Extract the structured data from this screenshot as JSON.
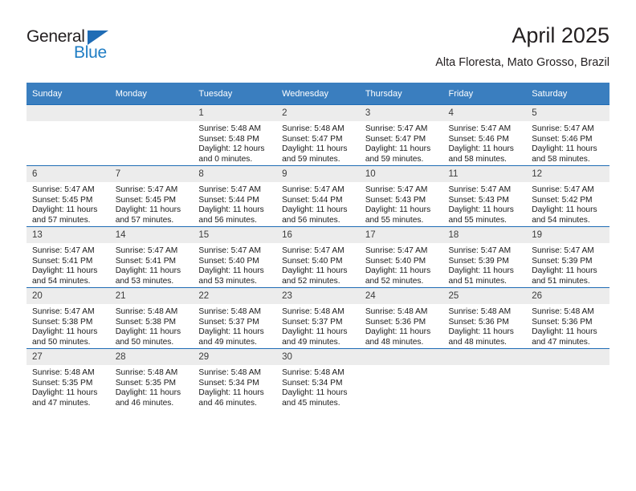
{
  "brand": {
    "name_top": "General",
    "name_bottom": "Blue",
    "accent_color": "#1f7dc4"
  },
  "header": {
    "title": "April 2025",
    "subtitle": "Alta Floresta, Mato Grosso, Brazil"
  },
  "calendar": {
    "header_bg": "#3a7ebf",
    "daynum_bg": "#ececec",
    "border_color": "#1f6cb5",
    "weekdays": [
      "Sunday",
      "Monday",
      "Tuesday",
      "Wednesday",
      "Thursday",
      "Friday",
      "Saturday"
    ],
    "weeks": [
      [
        {
          "day": "",
          "sunrise": "",
          "sunset": "",
          "daylight_1": "",
          "daylight_2": ""
        },
        {
          "day": "",
          "sunrise": "",
          "sunset": "",
          "daylight_1": "",
          "daylight_2": ""
        },
        {
          "day": "1",
          "sunrise": "Sunrise: 5:48 AM",
          "sunset": "Sunset: 5:48 PM",
          "daylight_1": "Daylight: 12 hours",
          "daylight_2": "and 0 minutes."
        },
        {
          "day": "2",
          "sunrise": "Sunrise: 5:48 AM",
          "sunset": "Sunset: 5:47 PM",
          "daylight_1": "Daylight: 11 hours",
          "daylight_2": "and 59 minutes."
        },
        {
          "day": "3",
          "sunrise": "Sunrise: 5:47 AM",
          "sunset": "Sunset: 5:47 PM",
          "daylight_1": "Daylight: 11 hours",
          "daylight_2": "and 59 minutes."
        },
        {
          "day": "4",
          "sunrise": "Sunrise: 5:47 AM",
          "sunset": "Sunset: 5:46 PM",
          "daylight_1": "Daylight: 11 hours",
          "daylight_2": "and 58 minutes."
        },
        {
          "day": "5",
          "sunrise": "Sunrise: 5:47 AM",
          "sunset": "Sunset: 5:46 PM",
          "daylight_1": "Daylight: 11 hours",
          "daylight_2": "and 58 minutes."
        }
      ],
      [
        {
          "day": "6",
          "sunrise": "Sunrise: 5:47 AM",
          "sunset": "Sunset: 5:45 PM",
          "daylight_1": "Daylight: 11 hours",
          "daylight_2": "and 57 minutes."
        },
        {
          "day": "7",
          "sunrise": "Sunrise: 5:47 AM",
          "sunset": "Sunset: 5:45 PM",
          "daylight_1": "Daylight: 11 hours",
          "daylight_2": "and 57 minutes."
        },
        {
          "day": "8",
          "sunrise": "Sunrise: 5:47 AM",
          "sunset": "Sunset: 5:44 PM",
          "daylight_1": "Daylight: 11 hours",
          "daylight_2": "and 56 minutes."
        },
        {
          "day": "9",
          "sunrise": "Sunrise: 5:47 AM",
          "sunset": "Sunset: 5:44 PM",
          "daylight_1": "Daylight: 11 hours",
          "daylight_2": "and 56 minutes."
        },
        {
          "day": "10",
          "sunrise": "Sunrise: 5:47 AM",
          "sunset": "Sunset: 5:43 PM",
          "daylight_1": "Daylight: 11 hours",
          "daylight_2": "and 55 minutes."
        },
        {
          "day": "11",
          "sunrise": "Sunrise: 5:47 AM",
          "sunset": "Sunset: 5:43 PM",
          "daylight_1": "Daylight: 11 hours",
          "daylight_2": "and 55 minutes."
        },
        {
          "day": "12",
          "sunrise": "Sunrise: 5:47 AM",
          "sunset": "Sunset: 5:42 PM",
          "daylight_1": "Daylight: 11 hours",
          "daylight_2": "and 54 minutes."
        }
      ],
      [
        {
          "day": "13",
          "sunrise": "Sunrise: 5:47 AM",
          "sunset": "Sunset: 5:41 PM",
          "daylight_1": "Daylight: 11 hours",
          "daylight_2": "and 54 minutes."
        },
        {
          "day": "14",
          "sunrise": "Sunrise: 5:47 AM",
          "sunset": "Sunset: 5:41 PM",
          "daylight_1": "Daylight: 11 hours",
          "daylight_2": "and 53 minutes."
        },
        {
          "day": "15",
          "sunrise": "Sunrise: 5:47 AM",
          "sunset": "Sunset: 5:40 PM",
          "daylight_1": "Daylight: 11 hours",
          "daylight_2": "and 53 minutes."
        },
        {
          "day": "16",
          "sunrise": "Sunrise: 5:47 AM",
          "sunset": "Sunset: 5:40 PM",
          "daylight_1": "Daylight: 11 hours",
          "daylight_2": "and 52 minutes."
        },
        {
          "day": "17",
          "sunrise": "Sunrise: 5:47 AM",
          "sunset": "Sunset: 5:40 PM",
          "daylight_1": "Daylight: 11 hours",
          "daylight_2": "and 52 minutes."
        },
        {
          "day": "18",
          "sunrise": "Sunrise: 5:47 AM",
          "sunset": "Sunset: 5:39 PM",
          "daylight_1": "Daylight: 11 hours",
          "daylight_2": "and 51 minutes."
        },
        {
          "day": "19",
          "sunrise": "Sunrise: 5:47 AM",
          "sunset": "Sunset: 5:39 PM",
          "daylight_1": "Daylight: 11 hours",
          "daylight_2": "and 51 minutes."
        }
      ],
      [
        {
          "day": "20",
          "sunrise": "Sunrise: 5:47 AM",
          "sunset": "Sunset: 5:38 PM",
          "daylight_1": "Daylight: 11 hours",
          "daylight_2": "and 50 minutes."
        },
        {
          "day": "21",
          "sunrise": "Sunrise: 5:48 AM",
          "sunset": "Sunset: 5:38 PM",
          "daylight_1": "Daylight: 11 hours",
          "daylight_2": "and 50 minutes."
        },
        {
          "day": "22",
          "sunrise": "Sunrise: 5:48 AM",
          "sunset": "Sunset: 5:37 PM",
          "daylight_1": "Daylight: 11 hours",
          "daylight_2": "and 49 minutes."
        },
        {
          "day": "23",
          "sunrise": "Sunrise: 5:48 AM",
          "sunset": "Sunset: 5:37 PM",
          "daylight_1": "Daylight: 11 hours",
          "daylight_2": "and 49 minutes."
        },
        {
          "day": "24",
          "sunrise": "Sunrise: 5:48 AM",
          "sunset": "Sunset: 5:36 PM",
          "daylight_1": "Daylight: 11 hours",
          "daylight_2": "and 48 minutes."
        },
        {
          "day": "25",
          "sunrise": "Sunrise: 5:48 AM",
          "sunset": "Sunset: 5:36 PM",
          "daylight_1": "Daylight: 11 hours",
          "daylight_2": "and 48 minutes."
        },
        {
          "day": "26",
          "sunrise": "Sunrise: 5:48 AM",
          "sunset": "Sunset: 5:36 PM",
          "daylight_1": "Daylight: 11 hours",
          "daylight_2": "and 47 minutes."
        }
      ],
      [
        {
          "day": "27",
          "sunrise": "Sunrise: 5:48 AM",
          "sunset": "Sunset: 5:35 PM",
          "daylight_1": "Daylight: 11 hours",
          "daylight_2": "and 47 minutes."
        },
        {
          "day": "28",
          "sunrise": "Sunrise: 5:48 AM",
          "sunset": "Sunset: 5:35 PM",
          "daylight_1": "Daylight: 11 hours",
          "daylight_2": "and 46 minutes."
        },
        {
          "day": "29",
          "sunrise": "Sunrise: 5:48 AM",
          "sunset": "Sunset: 5:34 PM",
          "daylight_1": "Daylight: 11 hours",
          "daylight_2": "and 46 minutes."
        },
        {
          "day": "30",
          "sunrise": "Sunrise: 5:48 AM",
          "sunset": "Sunset: 5:34 PM",
          "daylight_1": "Daylight: 11 hours",
          "daylight_2": "and 45 minutes."
        },
        {
          "day": "",
          "sunrise": "",
          "sunset": "",
          "daylight_1": "",
          "daylight_2": ""
        },
        {
          "day": "",
          "sunrise": "",
          "sunset": "",
          "daylight_1": "",
          "daylight_2": ""
        },
        {
          "day": "",
          "sunrise": "",
          "sunset": "",
          "daylight_1": "",
          "daylight_2": ""
        }
      ]
    ]
  }
}
